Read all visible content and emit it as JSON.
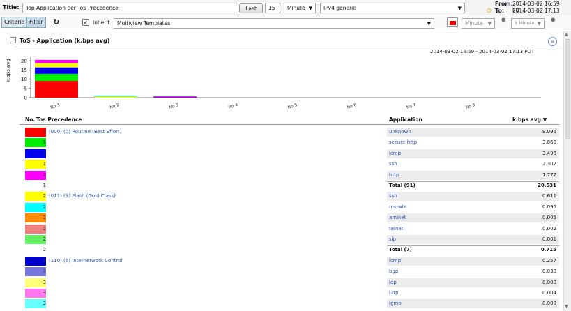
{
  "toolbar": {
    "title_label": "Title:",
    "title_value": "Top Application per ToS Precedence",
    "last_button": "Last",
    "last_count": "15",
    "unit": "Minute",
    "template": "IPv4 generic",
    "from_label": "From:",
    "from_value": "2014-03-02 16:59 PDT",
    "to_label": "To:",
    "to_value": "2014-03-02 17:13 PDT"
  },
  "tabs": {
    "criteria": "Criteria",
    "filter": "Filter"
  },
  "row2": {
    "inherit_label": "Inherit",
    "multiview": "Multiview Templates",
    "minute": "Minute",
    "five_minute": "5 Minute"
  },
  "section": {
    "title": "ToS - Application  (k.bps avg)",
    "timerange": "2014-03-02 16:59  - 2014-03-02 17:13 PDT"
  },
  "colors": {
    "red": "#ff0000",
    "green": "#00ee00",
    "blue": "#0000ee",
    "yellow": "#ffff00",
    "magenta": "#ff00ff",
    "cyan": "#00ffff",
    "orange": "#ff8c00",
    "salmon": "#f08080",
    "lightgreen": "#66ee66",
    "navy": "#0000cc",
    "slate": "#7777dd",
    "lightyellow": "#ffff77",
    "pink": "#ff77ee",
    "lightcyan": "#66ffff"
  },
  "chart_data": {
    "type": "bar",
    "stacked": true,
    "ylabel": "k.bps,avg",
    "ylim": [
      0,
      22
    ],
    "yticks": [
      "0",
      "5",
      "10",
      "15",
      "20"
    ],
    "categories": [
      "No 1",
      "No 2",
      "No 3",
      "No 4",
      "No 5",
      "No 6",
      "No 7",
      "No 8"
    ],
    "series": [
      {
        "color": "#ff0000",
        "values": [
          9.096,
          0.005,
          0,
          0,
          0,
          0,
          0,
          0
        ]
      },
      {
        "color": "#00ee00",
        "values": [
          3.86,
          0.001,
          0,
          0,
          0,
          0,
          0,
          0
        ]
      },
      {
        "color": "#0000ee",
        "values": [
          3.496,
          0,
          0.257,
          0,
          0,
          0,
          0,
          0
        ]
      },
      {
        "color": "#ffff00",
        "values": [
          2.302,
          0.611,
          0.008,
          0,
          0,
          0,
          0,
          0
        ]
      },
      {
        "color": "#ff00ff",
        "values": [
          1.777,
          0.002,
          0.004,
          0,
          0,
          0,
          0,
          0
        ]
      },
      {
        "color": "#00ffff",
        "values": [
          0,
          0.096,
          0,
          0,
          0,
          0,
          0,
          0
        ]
      }
    ]
  },
  "table": {
    "headers": {
      "no": "No.",
      "tos": "Tos Precedence",
      "app": "Application",
      "kbps": "k.bps avg"
    },
    "rows": [
      {
        "num": "1",
        "swatch": "#ff0000",
        "prec": "(000) (0) Routine (Best Effort)",
        "app": "unknown",
        "val": "9.096"
      },
      {
        "num": "1",
        "swatch": "#00ee00",
        "prec": "",
        "app": "secure-http",
        "val": "3.860"
      },
      {
        "num": "1",
        "swatch": "#0000ee",
        "prec": "",
        "app": "icmp",
        "val": "3.496"
      },
      {
        "num": "1",
        "swatch": "#ffff00",
        "prec": "",
        "app": "ssh",
        "val": "2.302"
      },
      {
        "num": "1",
        "swatch": "#ff00ff",
        "prec": "",
        "app": "http",
        "val": "1.777"
      },
      {
        "num": "1",
        "swatch": "",
        "prec": "",
        "app": "Total (91)",
        "val": "20.531",
        "total": true
      },
      {
        "num": "2",
        "swatch": "#ffff00",
        "prec": "(011) (3) Flash (Gold Class)",
        "app": "ssh",
        "val": "0.611"
      },
      {
        "num": "2",
        "swatch": "#00ffff",
        "prec": "",
        "app": "ms-wbt",
        "val": "0.096"
      },
      {
        "num": "2",
        "swatch": "#ff8c00",
        "prec": "",
        "app": "aminet",
        "val": "0.005"
      },
      {
        "num": "2",
        "swatch": "#f08080",
        "prec": "",
        "app": "telnet",
        "val": "0.002"
      },
      {
        "num": "2",
        "swatch": "#66ee66",
        "prec": "",
        "app": "sip",
        "val": "0.001"
      },
      {
        "num": "2",
        "swatch": "",
        "prec": "",
        "app": "Total (7)",
        "val": "0.715",
        "total": true
      },
      {
        "num": "3",
        "swatch": "#0000cc",
        "prec": "(110) (6) Internetwork Control",
        "app": "icmp",
        "val": "0.257"
      },
      {
        "num": "3",
        "swatch": "#7777dd",
        "prec": "",
        "app": "bgp",
        "val": "0.038"
      },
      {
        "num": "3",
        "swatch": "#ffff77",
        "prec": "",
        "app": "ldp",
        "val": "0.008"
      },
      {
        "num": "3",
        "swatch": "#ff77ee",
        "prec": "",
        "app": "l2tp",
        "val": "0.004"
      },
      {
        "num": "3",
        "swatch": "#66ffff",
        "prec": "",
        "app": "igmp",
        "val": "0.000"
      }
    ]
  }
}
